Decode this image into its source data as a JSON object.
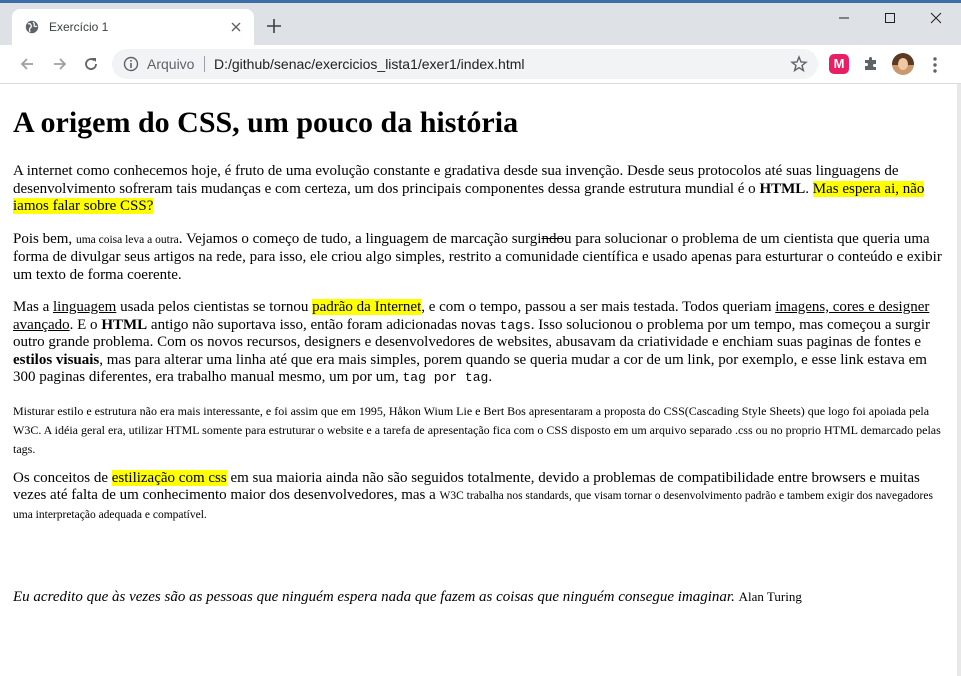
{
  "browser": {
    "tab_title": "Exercício 1",
    "url_scheme_label": "Arquivo",
    "url": "D:/github/senac/exercicios_lista1/exer1/index.html",
    "extension_label": "M"
  },
  "page": {
    "heading": "A origem do CSS, um pouco da história",
    "p1": {
      "text_a": "A internet como conhecemos hoje, é fruto de uma evolução constante e gradativa desde sua invenção. Desde seus protocolos até suas linguagens de desenvolvimento sofreram tais mudanças e com certeza, um dos principais componentes dessa grande estrutura mundial é o ",
      "strong": "HTML",
      "text_b": ". ",
      "mark": "Mas espera ai, não iamos falar sobre CSS?"
    },
    "p2": {
      "text_a": "Pois bem, ",
      "small": "uma coisa leva a outra",
      "text_b": ". Vejamos o começo de tudo, a linguagem de marcação surgi",
      "strike": "ndo",
      "text_c": "u para solucionar o problema de um cientista que queria uma forma de divulgar seus artigos na rede, para isso, ele criou algo simples, restrito a comunidade científica e usado apenas para esturturar o conteúdo e exibir um texto de forma coerente."
    },
    "p3": {
      "text_a": "Mas a ",
      "u1": "linguagem",
      "text_b": " usada pelos cientistas se tornou ",
      "mark": "padrão da Internet",
      "text_c": ", e com o tempo, passou a ser mais testada. Todos queriam ",
      "u2": "imagens, cores e designer avançado",
      "text_d": ". E o ",
      "strong1": "HTML",
      "text_e": " antigo não suportava isso, então foram adicionadas novas ",
      "code1": "tags",
      "text_f": ". Isso solucionou o problema por um tempo, mas começou a surgir outro grande problema. Com os novos recursos, designers e desenvolvedores de websites, abusavam da criatividade e enchiam suas paginas de fontes e ",
      "strong2": "estilos visuais",
      "text_g": ", mas para alterar uma linha até que era mais simples, porem quando se queria mudar a cor de um link, por exemplo, e esse link estava em 300 paginas diferentes, era trabalho manual mesmo, um por um, ",
      "code2": "tag por tag",
      "text_h": "."
    },
    "p4": "Misturar estilo e estrutura não era mais interessante, e foi assim que em 1995, Håkon Wium Lie e Bert Bos apresentaram a proposta do CSS(Cascading Style Sheets) que logo foi apoiada pela W3C. A idéia geral era, utilizar HTML somente para estruturar o website e a tarefa de apresentação fica com o CSS disposto em um arquivo separado .css ou no proprio HTML demarcado pelas tags.",
    "p5": {
      "text_a": "Os conceitos de ",
      "mark": "estilização com css",
      "text_b": " em sua maioria ainda não são seguidos totalmente, devido a problemas de compatibilidade entre browsers e muitas vezes até falta de um conhecimento maior dos desenvolvedores, mas a ",
      "small": "W3C trabalha nos standards, que visam tornar o desenvolvimento padrão e tambem exigir dos navegadores uma interpretação adequada e compatível."
    },
    "quote": "Eu acredito que às vezes são as pessoas que ninguém espera nada que fazem as coisas que ninguém consegue imaginar.",
    "author": "Alan Turing"
  }
}
